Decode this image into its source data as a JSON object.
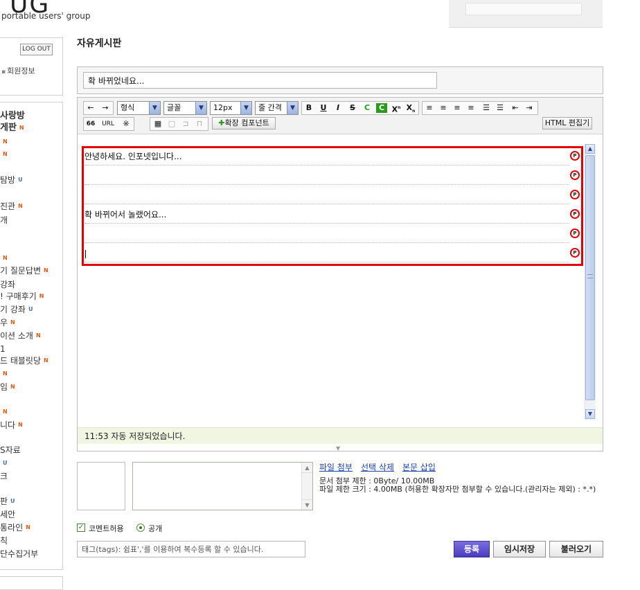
{
  "header": {
    "logo_letters": "UG",
    "logo_sub": "portable users' group"
  },
  "sidebar": {
    "logout_label": "LOG OUT",
    "member_info": "회원정보",
    "items": [
      {
        "label": "사랑방",
        "badge": ""
      },
      {
        "label": "게판",
        "badge": "N"
      },
      {
        "label": "",
        "badge": "N"
      },
      {
        "label": "",
        "badge": "N"
      },
      {
        "label": "탐방",
        "badge": "U"
      },
      {
        "label": "진관",
        "badge": "N"
      },
      {
        "label": "개",
        "badge": ""
      },
      {
        "label": "",
        "badge": "N"
      },
      {
        "label": "기 질문답변",
        "badge": "N"
      },
      {
        "label": "강좌",
        "badge": ""
      },
      {
        "label": "! 구매후기",
        "badge": "N"
      },
      {
        "label": "기 강좌",
        "badge": "U"
      },
      {
        "label": "우",
        "badge": "N"
      },
      {
        "label": "이션 소개",
        "badge": "N"
      },
      {
        "label": "1",
        "badge": ""
      },
      {
        "label": "드 태블릿당",
        "badge": "N"
      },
      {
        "label": "",
        "badge": "N"
      },
      {
        "label": "임",
        "badge": "N"
      },
      {
        "label": "",
        "badge": "N"
      },
      {
        "label": "니다",
        "badge": "N"
      },
      {
        "label": "S자료",
        "badge": ""
      },
      {
        "label": "",
        "badge": "U"
      },
      {
        "label": "크",
        "badge": ""
      },
      {
        "label": "판",
        "badge": "U"
      },
      {
        "label": "세안",
        "badge": ""
      },
      {
        "label": "통라인",
        "badge": "N"
      },
      {
        "label": "칙",
        "badge": ""
      },
      {
        "label": "단수집거부",
        "badge": ""
      }
    ]
  },
  "page": {
    "title": "자유게시판"
  },
  "post": {
    "subject": "확 바뀌었네요..."
  },
  "toolbar": {
    "undo": "←",
    "redo": "→",
    "format_select": "형식",
    "font_select": "글꼴",
    "size_select": "12px",
    "line_select": "줄 간격",
    "bold": "B",
    "underline": "U",
    "italic": "I",
    "strike": "S",
    "font_color": "C",
    "bg_color": "C",
    "superscript": "X",
    "subscript": "X",
    "align_left": "≡",
    "align_center": "≡",
    "align_right": "≡",
    "align_justify": "≡",
    "ordered_list": "☰",
    "unordered_list": "☰",
    "outdent": "⇤",
    "indent": "⇥",
    "quote": "66",
    "url": "URL",
    "special_char": "※",
    "extension_label": "확장 컴포넌트",
    "html_editor_label": "HTML 편집기"
  },
  "editor": {
    "lines": [
      "안녕하세요. 인포넷입니다...",
      "",
      "",
      "확 바뀌어서 놀랬어요...",
      "",
      ""
    ],
    "paragraph_marker": "P",
    "selection_color": "#e00000"
  },
  "status": {
    "autosave_text": "11:53 자동 저장되었습니다."
  },
  "attachments": {
    "attach_link": "파일 첨부",
    "delete_link": "선택 삭제",
    "insert_link": "본문 삽입",
    "doc_limit": "문서 첨부 제한 : 0Byte/ 10.00MB",
    "file_limit": "파일 제한 크기 : 4.00MB (허용한 확장자만 첨부할 수 있습니다.(관리자는 제외) : *.*)"
  },
  "options": {
    "comment_label": "코멘트허용",
    "public_label": "공개"
  },
  "tags": {
    "placeholder": "태그(tags): 쉼표','를 이용하여 복수등록 할 수 있습니다."
  },
  "buttons": {
    "submit": "등록",
    "temp_save": "임시저장",
    "load": "불러오기"
  },
  "colors": {
    "accent_purple": "#4a3cbf",
    "link_blue": "#1a3fa8",
    "new_badge": "#e05a10",
    "status_bg": "#f1f6e2"
  }
}
